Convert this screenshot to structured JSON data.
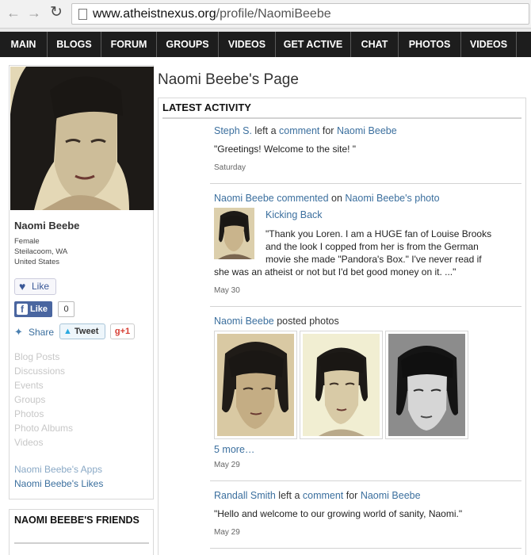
{
  "browser": {
    "url_host": "www.atheistnexus.org",
    "url_path": "/profile/NaomiBeebe"
  },
  "nav": {
    "items": [
      "MAIN",
      "BLOGS",
      "FORUM",
      "GROUPS",
      "VIDEOS",
      "GET ACTIVE",
      "CHAT",
      "PHOTOS",
      "VIDEOS"
    ]
  },
  "profile": {
    "name": "Naomi Beebe",
    "gender": "Female",
    "city": "Steilacoom, WA",
    "country": "United States",
    "like_label": "Like",
    "fb_like_label": "Like",
    "fb_like_count": "0",
    "share_label": "Share",
    "tweet_label": "Tweet",
    "gplus_label": "+1",
    "links": [
      "Blog Posts",
      "Discussions",
      "Events",
      "Groups",
      "Photos",
      "Photo Albums",
      "Videos"
    ],
    "apps_link": "Naomi Beebe's Apps",
    "likes_link": "Naomi Beebe's Likes",
    "friends_title": "NAOMI BEEBE'S FRIENDS"
  },
  "main": {
    "page_title": "Naomi Beebe's Page",
    "section_title": "LATEST ACTIVITY",
    "activity": [
      {
        "actor": "Steph S.",
        "verb": " left a ",
        "object": "comment",
        "prep": " for ",
        "target": "Naomi Beebe",
        "quote": "\"Greetings! Welcome to the site! \"",
        "date": "Saturday"
      },
      {
        "actor": "Naomi Beebe",
        "verb": " commented",
        "prep": " on ",
        "target": "Naomi Beebe's photo",
        "photo_title": "Kicking Back",
        "quote_lines": [
          "\"Thank you Loren.  I am a HUGE fan of Louise Brooks",
          "and the look I copped from her is from the German",
          "movie she made \"Pandora's Box.\"  I've never read if",
          "she was an atheist or not but I'd bet good money on it. ...\""
        ],
        "date": "May 30"
      },
      {
        "actor": "Naomi Beebe",
        "verb": " posted photos",
        "more_link": "5 more…",
        "date": "May 29"
      },
      {
        "actor": "Randall Smith",
        "verb": " left a ",
        "object": "comment",
        "prep": " for ",
        "target": "Naomi Beebe",
        "quote": "\"Hello and welcome to our growing world of sanity, Naomi.\"",
        "date": "May 29"
      }
    ]
  },
  "colors": {
    "link": "#3b6f9e",
    "nav_bg": "#1d1d1d",
    "facebook": "#4a66a0",
    "twitter": "#2aa9e0",
    "gplus": "#d73d32"
  },
  "icons": [
    "back-arrow-icon",
    "forward-arrow-icon",
    "reload-icon",
    "page-icon",
    "heart-icon",
    "facebook-icon",
    "share-icon",
    "twitter-bird-icon"
  ]
}
